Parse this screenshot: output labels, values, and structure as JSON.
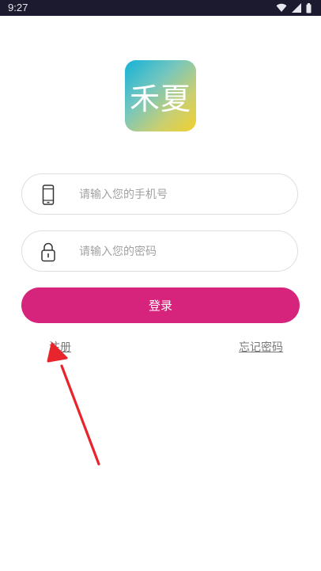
{
  "status_bar": {
    "time": "9:27",
    "icons": [
      "wifi-icon",
      "signal-icon",
      "battery-icon"
    ]
  },
  "app": {
    "logo_text": "禾夏"
  },
  "form": {
    "phone": {
      "icon": "phone-icon",
      "placeholder": "请输入您的手机号",
      "value": ""
    },
    "password": {
      "icon": "lock-icon",
      "placeholder": "请输入您的密码",
      "value": ""
    },
    "login_label": "登录"
  },
  "links": {
    "register_label": "注册",
    "forgot_label": "忘记密码"
  },
  "annotation": {
    "type": "arrow",
    "color": "#e8242c",
    "points_to": "register-link"
  },
  "colors": {
    "status_bar_bg": "#1b1a2e",
    "primary": "#d6237b",
    "logo_gradient": [
      "#13b2d8",
      "#f2d02e"
    ]
  }
}
